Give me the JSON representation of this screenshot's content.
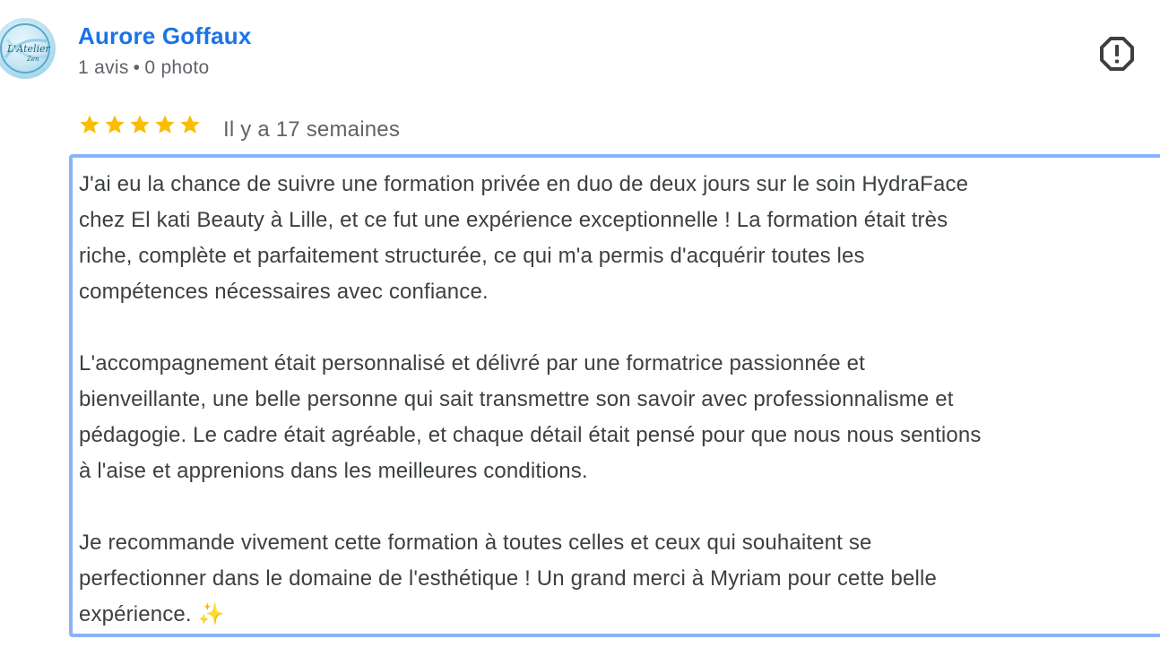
{
  "author": {
    "name": "Aurore Goffaux",
    "review_count": "1 avis",
    "separator": "•",
    "photo_count": "0 photo",
    "avatar_icon": "avatar-logo-icon"
  },
  "actions": {
    "flag_icon": "report-flag-icon"
  },
  "rating": {
    "stars": 5,
    "max": 5,
    "star_color": "#fbbc04",
    "date": "Il y a 17 semaines"
  },
  "review": {
    "paragraphs": [
      "J'ai eu la chance de suivre une formation privée en duo de deux jours sur le soin HydraFace\nchez El kati Beauty à Lille, et ce fut une expérience exceptionnelle ! La formation était très\nriche, complète et parfaitement structurée, ce qui m'a permis d'acquérir toutes les\ncompétences nécessaires avec confiance.",
      "L'accompagnement était personnalisé et délivré par une formatrice passionnée et\nbienveillante, une belle personne qui sait transmettre son savoir avec professionnalisme et\npédagogie. Le cadre était agréable, et chaque détail était pensé pour que nous nous sentions\nà l'aise et apprenions dans les meilleures conditions.",
      "Je recommande vivement cette formation à toutes celles et ceux qui souhaitent se\nperfectionner dans le domaine de l'esthétique ! Un grand merci à Myriam pour cette belle\nexpérience. ✨"
    ]
  },
  "colors": {
    "name_link": "#1a73e8",
    "focus_border": "#8ab4f8",
    "meta_text": "#5f6368",
    "body_text": "#3c4043"
  }
}
